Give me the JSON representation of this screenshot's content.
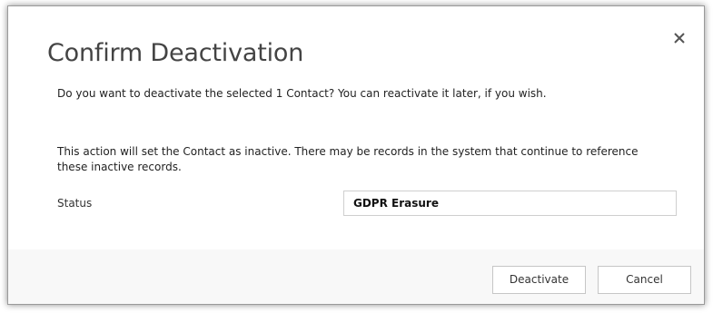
{
  "dialog": {
    "title": "Confirm Deactivation",
    "question": "Do you want to deactivate the selected 1 Contact? You can reactivate it later, if you wish.",
    "info": "This action will set the Contact as inactive. There may be records in the system that continue to reference these inactive records.",
    "status_label": "Status",
    "status_value": "GDPR Erasure",
    "close_icon": "close-icon"
  },
  "buttons": {
    "deactivate": "Deactivate",
    "cancel": "Cancel"
  },
  "colors": {
    "title": "#444444",
    "footer": "#f8f8f8",
    "border": "#c6c6c6"
  }
}
